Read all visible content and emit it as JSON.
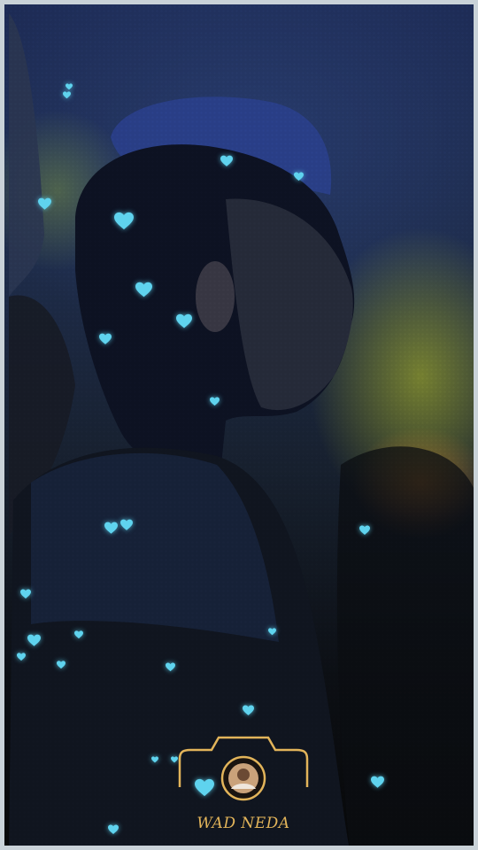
{
  "watermark": {
    "text": "WAD NEDA",
    "color": "#e2b45a",
    "icon": "camera-frame-icon"
  },
  "accent": {
    "heart_color": "#5fd3ee"
  }
}
